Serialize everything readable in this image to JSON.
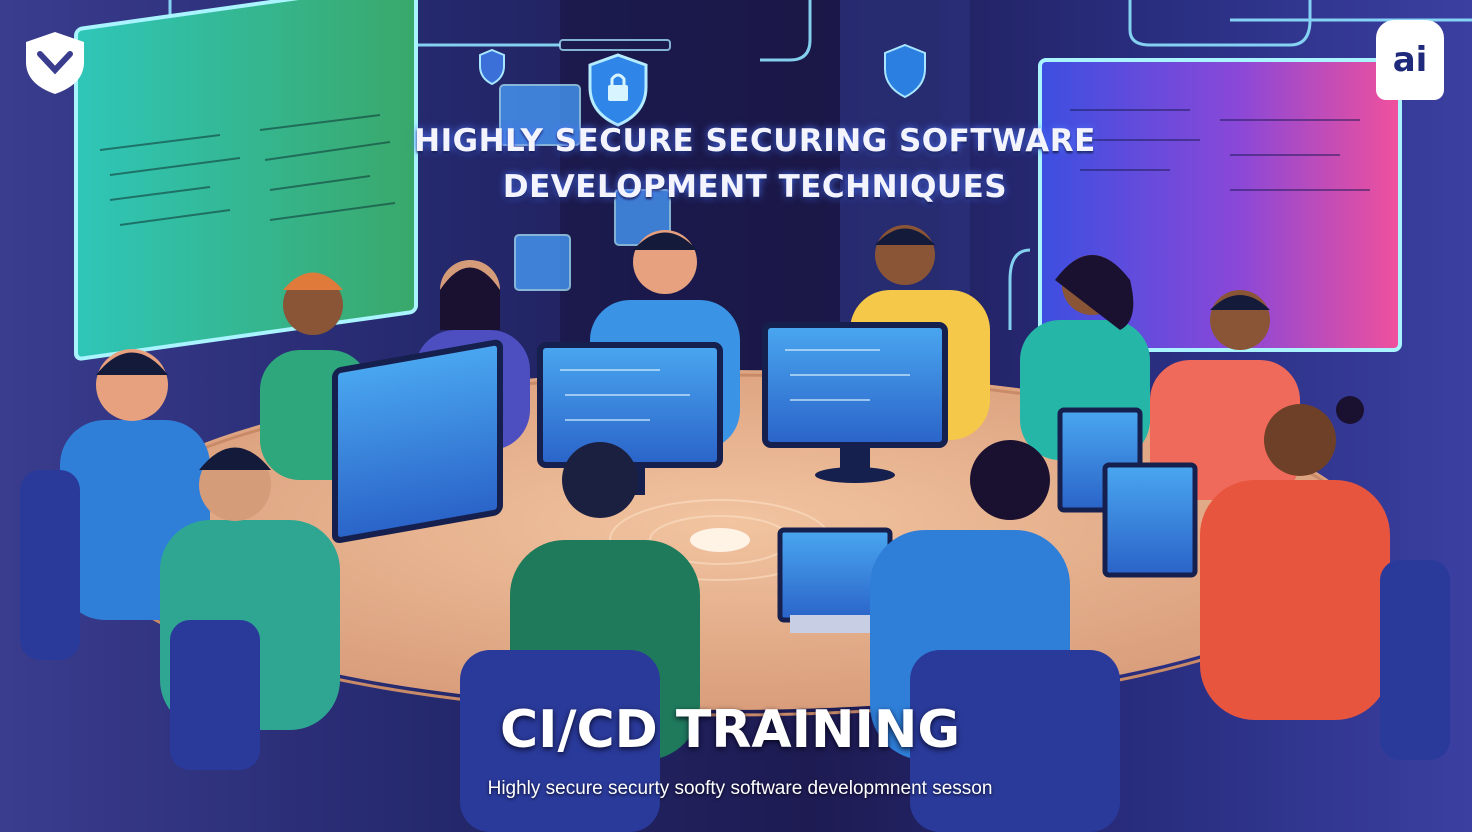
{
  "headline": {
    "line1": "HIGHLY SECURE SECURING SOFTWARE",
    "line2": "DEVELOPMENT TECHNIQUES"
  },
  "title": "CI/CD TRAINING",
  "subtitle": "Highly secure securty soofty software developmnent sesson",
  "logo_right_text": "ai",
  "icons": [
    "shield-logo-icon",
    "shield-icon",
    "padlock-shield-icon",
    "ai-badge-icon"
  ],
  "colors": {
    "background": "#24286c",
    "table": "#e9b48e",
    "screen_blue": "#3f8fe0",
    "screen_left": "#38c9b4",
    "screen_right": "#e855a8",
    "neon": "#7fd8ff"
  }
}
